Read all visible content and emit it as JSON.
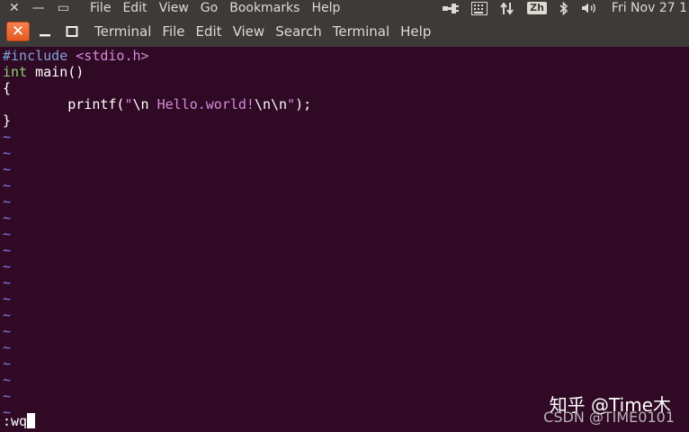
{
  "system_panel": {
    "menu": [
      "File",
      "Edit",
      "View",
      "Go",
      "Bookmarks",
      "Help"
    ],
    "input_method": "Zh",
    "clock": "Fri Nov 27 1"
  },
  "terminal_window": {
    "menu": [
      "Terminal",
      "File",
      "Edit",
      "View",
      "Search",
      "Terminal",
      "Help"
    ]
  },
  "editor": {
    "line1_preprocessor": "#include",
    "line1_header": "<stdio.h>",
    "line2_type": "int",
    "line2_rest": " main()",
    "line3": "{",
    "line4_indent": "        ",
    "line4_func": "printf(",
    "line4_quote_open": "\"",
    "line4_esc1": "\\n",
    "line4_text": " Hello.world!",
    "line4_esc2": "\\n\\n",
    "line4_quote_close": "\"",
    "line4_end": ");",
    "line5": "}",
    "tilde": "~",
    "command": ":wq"
  },
  "watermarks": {
    "zhihu": "知乎 @Time木",
    "csdn": "CSDN @TIME0101"
  },
  "colors": {
    "background": "#300a24",
    "panel": "#3c3b37",
    "close_button": "#e5581f",
    "tilde": "#7e7ef4",
    "keyword": "#86d36c",
    "string": "#d38adb"
  }
}
